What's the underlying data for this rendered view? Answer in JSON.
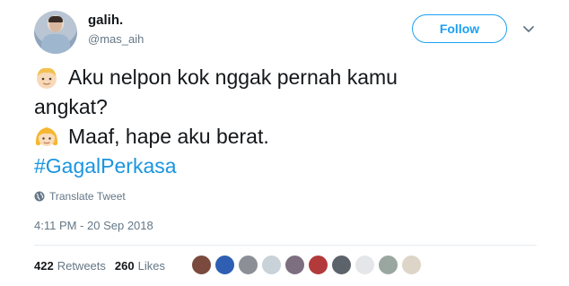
{
  "user": {
    "name": "galih.",
    "handle": "@mas_aih",
    "avatar_icon": "profile-photo"
  },
  "follow_button": {
    "label": "Follow",
    "color": "#1da1f2"
  },
  "caret_icon": "chevron-down-icon",
  "tweet": {
    "line1_emoji": "boy-emoji",
    "line1": "Aku nelpon kok nggak pernah kamu",
    "line2": "angkat?",
    "line3_emoji": "girl-emoji",
    "line3": "Maaf, hape aku berat.",
    "hashtag": "#GagalPerkasa",
    "hashtag_color": "#1b95e0"
  },
  "translate": {
    "icon": "globe-icon",
    "label": "Translate Tweet"
  },
  "timestamp": "4:11 PM - 20 Sep 2018",
  "stats": {
    "retweets_count": "422",
    "retweets_label": "Retweets",
    "likes_count": "260",
    "likes_label": "Likes"
  },
  "likers": [
    {
      "color": "#7a4a3e"
    },
    {
      "color": "#2f5fb3"
    },
    {
      "color": "#8c8f96"
    },
    {
      "color": "#c9d1d9"
    },
    {
      "color": "#7d6f80"
    },
    {
      "color": "#b33a3a"
    },
    {
      "color": "#5c636b"
    },
    {
      "color": "#e4e6ea"
    },
    {
      "color": "#9aa7a0"
    },
    {
      "color": "#ddd5c8"
    }
  ]
}
